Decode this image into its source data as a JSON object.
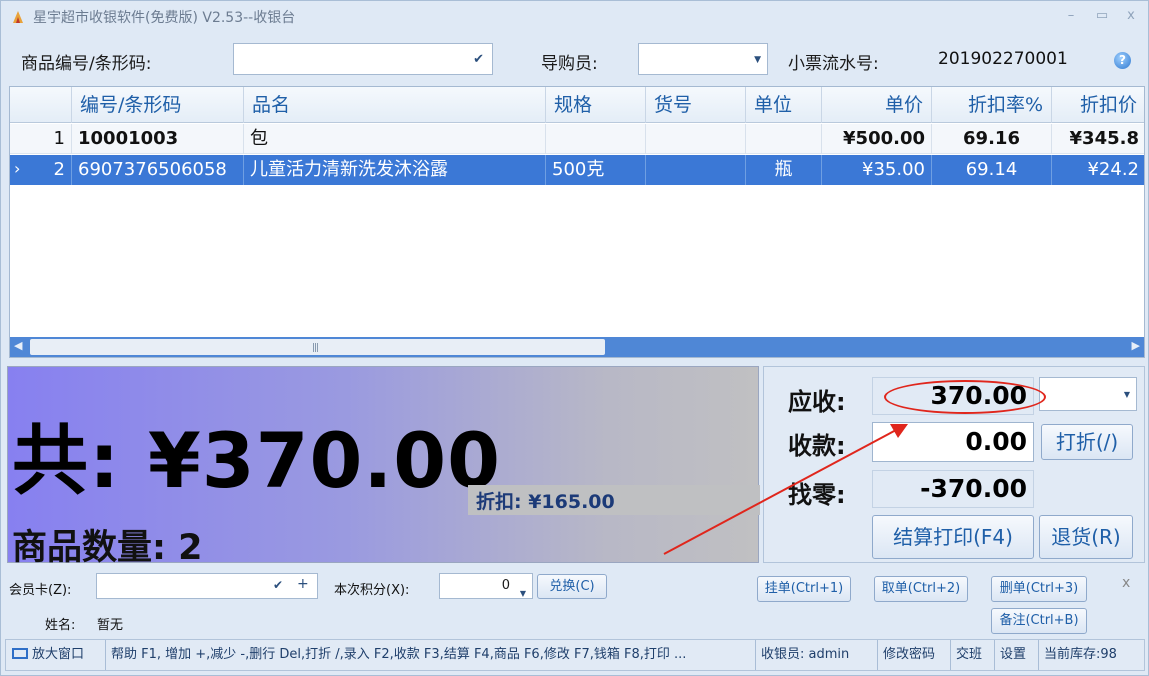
{
  "window": {
    "title": "星宇超市收银软件(免费版) V2.53--收银台",
    "controls": {
      "minimize": "–",
      "maximize": "▭",
      "close": "x"
    }
  },
  "query": {
    "barcode_label": "商品编号/条形码:",
    "barcode_value": "",
    "guide_label": "导购员:",
    "guide_value": "",
    "ticket_label": "小票流水号:",
    "ticket_no": "201902270001",
    "help_glyph": "?"
  },
  "grid": {
    "columns": [
      "编号/条形码",
      "品名",
      "规格",
      "货号",
      "单位",
      "单价",
      "折扣率%",
      "折扣价"
    ],
    "rows": [
      {
        "idx": "1",
        "code": "10001003",
        "name": "包",
        "spec": "",
        "item_no": "",
        "unit": "",
        "price": "¥500.00",
        "rate": "69.16",
        "disc_price": "¥345.8"
      },
      {
        "idx": "2",
        "code": "6907376506058",
        "name": "儿童活力清新洗发沐浴露",
        "spec": "500克",
        "item_no": "",
        "unit": "瓶",
        "price": "¥35.00",
        "rate": "69.14",
        "disc_price": "¥24.2"
      }
    ],
    "current_row_marker": "›",
    "scroll_grip": "|||"
  },
  "totals": {
    "total_text": "共: ¥370.00",
    "discount_text": "折扣: ¥165.00",
    "qty_text": "商品数量: 2"
  },
  "payment": {
    "receivable_label": "应收:",
    "receivable_value": "370.00",
    "received_label": "收款:",
    "received_value": "0.00",
    "change_label": "找零:",
    "change_value": "-370.00",
    "discount_button": "打折(/)",
    "checkout_button": "结算打印(F4)",
    "refund_button": "退货(R)"
  },
  "member": {
    "card_label": "会员卡(Z):",
    "card_value": "",
    "points_label": "本次积分(X):",
    "points_value": "0",
    "redeem_button": "兑换(C)",
    "name_label": "姓名:",
    "name_value": "暂无"
  },
  "order_buttons": {
    "hold": "挂单(Ctrl+1)",
    "retrieve": "取单(Ctrl+2)",
    "delete": "删单(Ctrl+3)",
    "note": "备注(Ctrl+B)",
    "close": "x"
  },
  "statusbar": {
    "zoom": "放大窗口",
    "help": "帮助 F1, 增加 +,减少 -,删行 Del,打折 /,录入 F2,收款 F3,结算 F4,商品 F6,修改 F7,钱箱 F8,打印 ...",
    "cashier": "收银员: admin",
    "change_password": "修改密码",
    "shift": "交班",
    "settings": "设置",
    "stock": "当前库存:98"
  },
  "colors": {
    "selection": "#3b78d6",
    "annotation": "#e0261c",
    "accent": "#1f5fa8"
  }
}
